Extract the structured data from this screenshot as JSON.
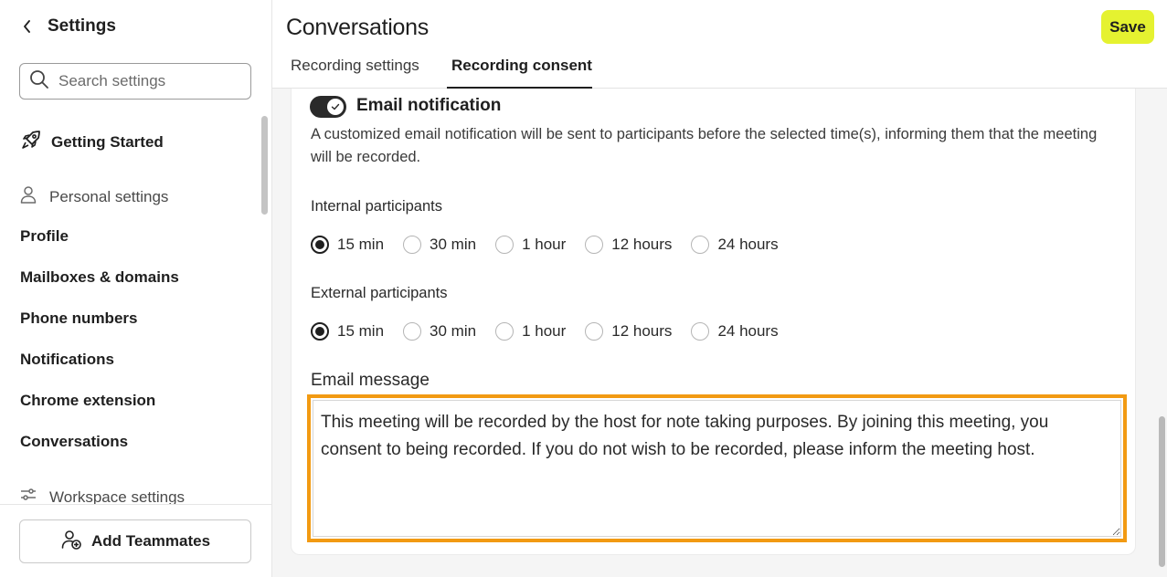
{
  "sidebar": {
    "title": "Settings",
    "search_placeholder": "Search settings",
    "getting_started": "Getting Started",
    "personal_section": "Personal settings",
    "items": [
      "Profile",
      "Mailboxes & domains",
      "Phone numbers",
      "Notifications",
      "Chrome extension",
      "Conversations"
    ],
    "workspace_section": "Workspace settings",
    "add_teammates": "Add Teammates"
  },
  "header": {
    "title": "Conversations",
    "save_label": "Save",
    "save_color": "#e5f230",
    "tabs": [
      {
        "label": "Recording settings",
        "active": false
      },
      {
        "label": "Recording consent",
        "active": true
      }
    ]
  },
  "email_notification": {
    "label": "Email notification",
    "enabled": true,
    "description": "A customized email notification will be sent to participants before the selected time(s), informing them that the meeting will be recorded."
  },
  "internal": {
    "label": "Internal participants",
    "options": [
      "15 min",
      "30 min",
      "1 hour",
      "12 hours",
      "24 hours"
    ],
    "selected": "15 min"
  },
  "external": {
    "label": "External participants",
    "options": [
      "15 min",
      "30 min",
      "1 hour",
      "12 hours",
      "24 hours"
    ],
    "selected": "15 min"
  },
  "email_message": {
    "label": "Email message",
    "value": "This meeting will be recorded by the host for note taking purposes. By joining this meeting, you consent to being recorded. If you do not wish to be recorded, please inform the meeting host.",
    "highlight_color": "#f29a12"
  }
}
